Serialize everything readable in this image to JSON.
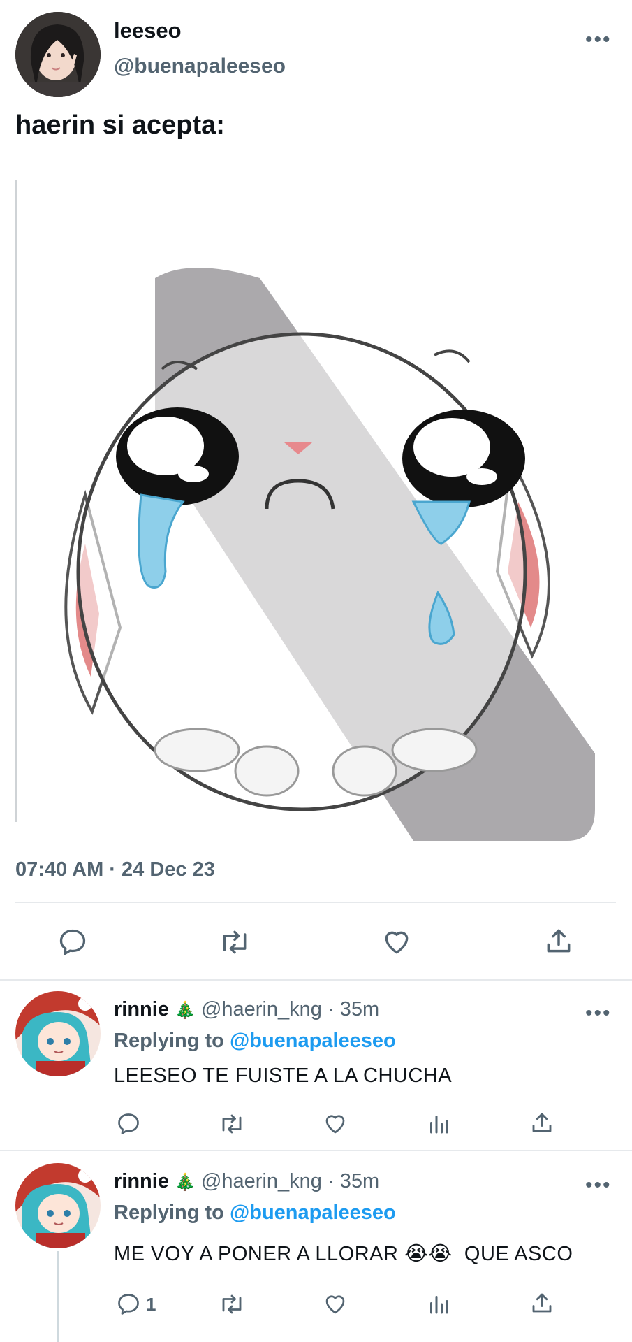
{
  "tweet": {
    "author_name": "leeseo",
    "author_handle": "@buenapaleeseo",
    "text": "haerin si acepta:",
    "timestamp": "07:40 AM · 24 Dec 23",
    "more_icon": "more-dots-icon"
  },
  "actions": [
    "reply-icon",
    "retweet-icon",
    "like-icon",
    "share-icon"
  ],
  "replies": [
    {
      "name": "rinnie",
      "name_emoji": "🎄",
      "handle": "@haerin_kng",
      "sep": "·",
      "time": "35m",
      "replying_label": "Replying to",
      "replying_handle": "@buenapaleeseo",
      "text": "LEESEO TE FUISTE A LA CHUCHA",
      "reply_count": ""
    },
    {
      "name": "rinnie",
      "name_emoji": "🎄",
      "handle": "@haerin_kng",
      "sep": "·",
      "time": "35m",
      "replying_label": "Replying to",
      "replying_handle": "@buenapaleeseo",
      "text": "ME VOY A PONER A LLORAR 😭😭  QUE ASCO",
      "reply_count": "1"
    }
  ],
  "colors": {
    "text": "#0f1419",
    "secondary": "#536471",
    "link": "#1d9bf0"
  }
}
